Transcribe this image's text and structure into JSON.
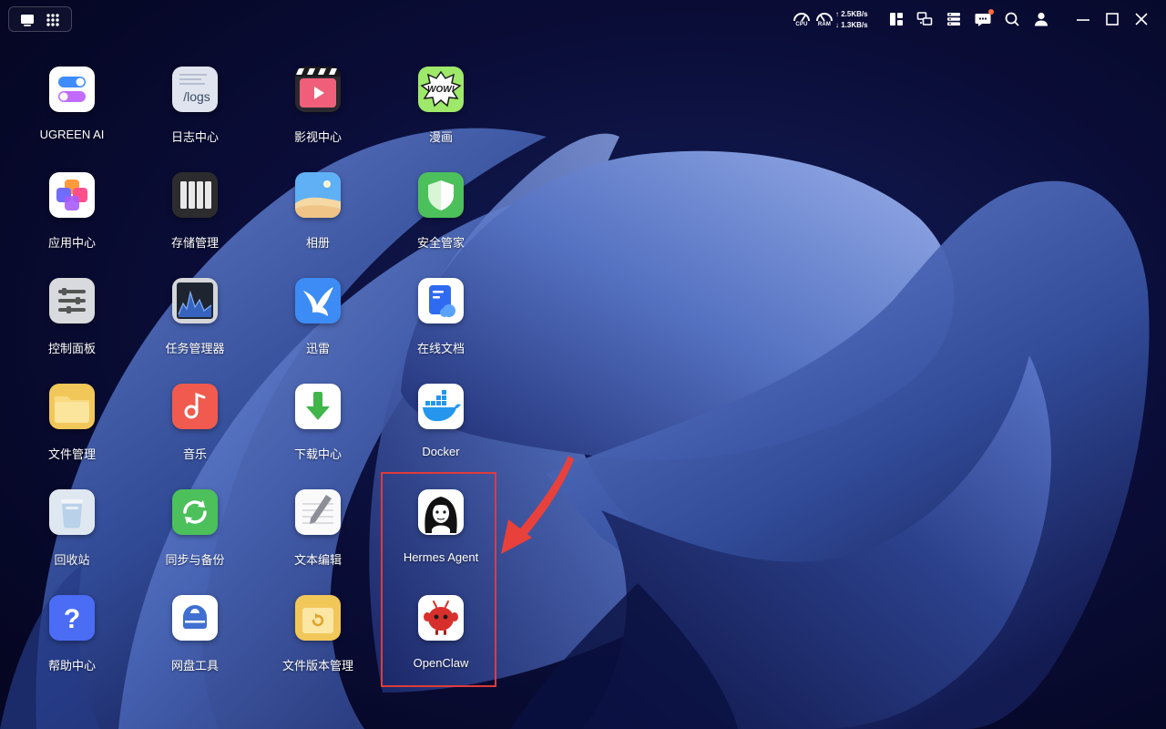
{
  "topbar": {
    "left_buttons": [
      {
        "icon": "desktop-icon"
      },
      {
        "icon": "app-grid-icon"
      }
    ],
    "cpu_label": "CPU",
    "ram_label": "RAM",
    "net_up": "2.5KB/s",
    "net_down": "1.3KB/s",
    "buttons": [
      {
        "icon": "widgets-icon"
      },
      {
        "icon": "multi-screen-icon"
      },
      {
        "icon": "server-status-icon"
      },
      {
        "icon": "message-icon"
      },
      {
        "icon": "search-icon"
      },
      {
        "icon": "user-icon"
      },
      {
        "icon": "minimize-icon"
      },
      {
        "icon": "maximize-icon"
      },
      {
        "icon": "close-icon"
      }
    ],
    "notification_color": "#ff6a3d"
  },
  "apps": {
    "ugreen_ai": "UGREEN AI",
    "log_center": "日志中心",
    "log_tile_text": "/logs",
    "video_center": "影视中心",
    "comics": "漫画",
    "comics_tile_text": "WOW!",
    "app_center": "应用中心",
    "storage": "存储管理",
    "photos": "相册",
    "security": "安全管家",
    "control_panel": "控制面板",
    "task_manager": "任务管理器",
    "thunder": "迅雷",
    "online_docs": "在线文档",
    "file_manager": "文件管理",
    "music": "音乐",
    "download_center": "下载中心",
    "docker": "Docker",
    "recycle_bin": "回收站",
    "sync_backup": "同步与备份",
    "text_editor": "文本编辑",
    "hermes_agent": "Hermes Agent",
    "help_center": "帮助中心",
    "cloud_drive": "网盘工具",
    "file_version": "文件版本管理",
    "openclaw": "OpenClaw"
  },
  "annotation": {
    "highlight_color": "#e03a3a"
  }
}
